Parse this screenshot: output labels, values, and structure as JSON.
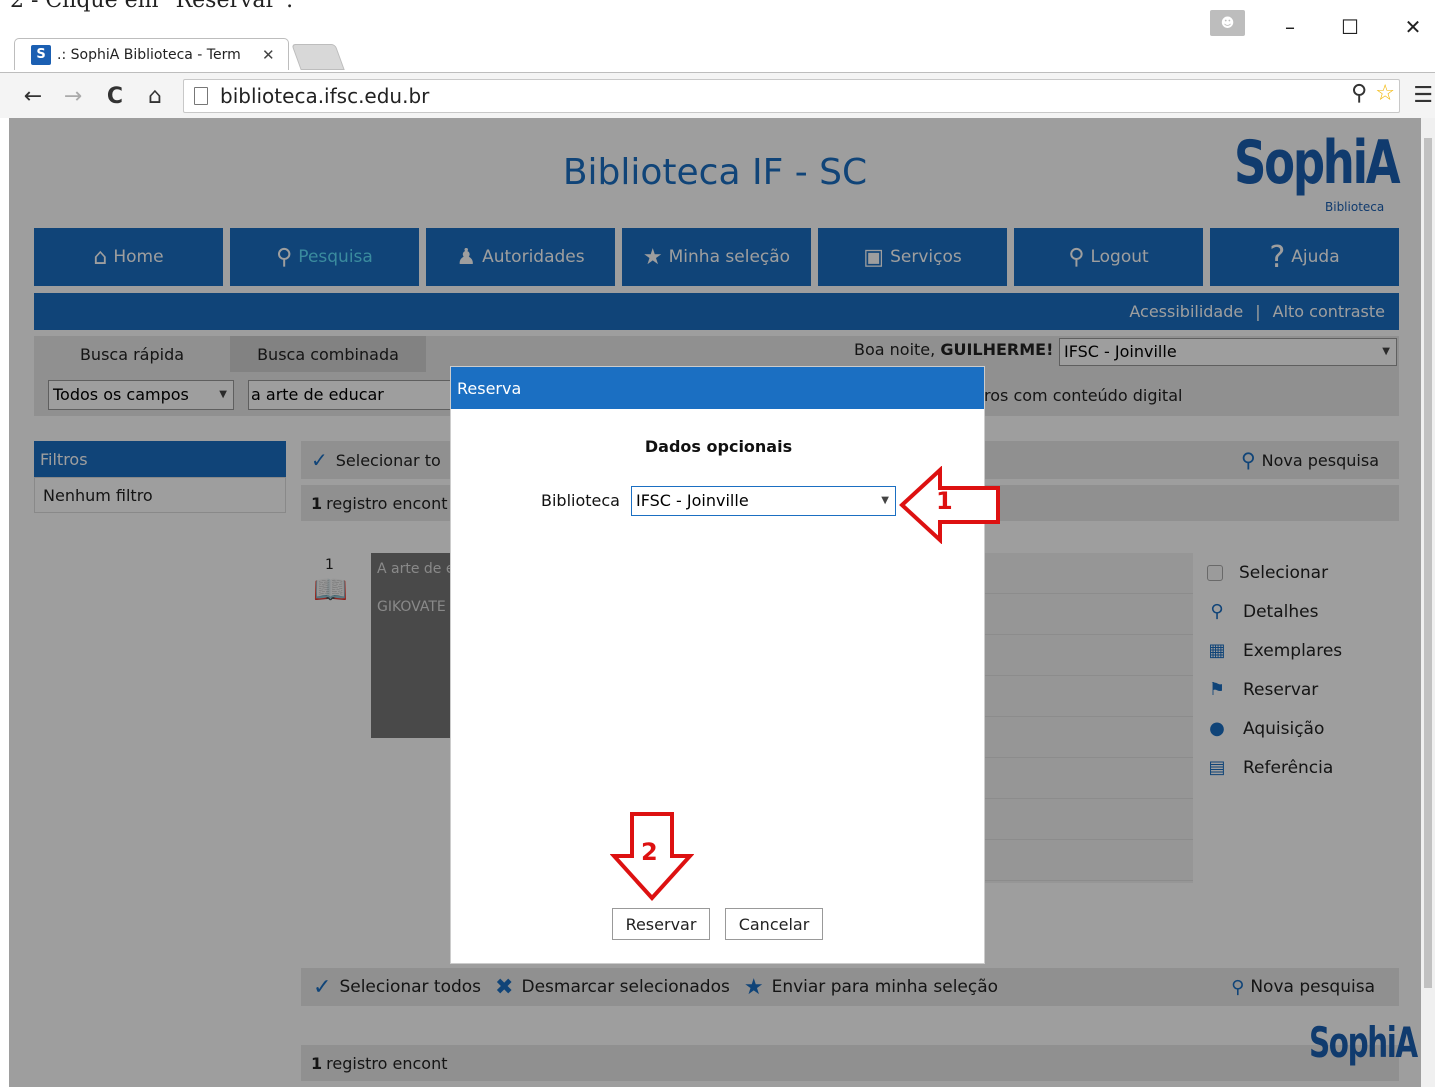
{
  "instruction": "2 - Clique em \"Reservar\".",
  "window": {
    "minimize": "–",
    "maximize": "☐",
    "close": "✕"
  },
  "tab": {
    "favicon": "S",
    "title": ".: SophiA Biblioteca - Term",
    "close": "✕"
  },
  "address": {
    "url": "biblioteca.ifsc.edu.br"
  },
  "site": {
    "title": "Biblioteca IF - SC",
    "logo": "SophiA",
    "logo_sub": "Biblioteca"
  },
  "nav": [
    {
      "label": "Home",
      "icon": "home-icon"
    },
    {
      "label": "Pesquisa",
      "icon": "search-icon"
    },
    {
      "label": "Autoridades",
      "icon": "authors-icon"
    },
    {
      "label": "Minha seleção",
      "icon": "star-icon"
    },
    {
      "label": "Serviços",
      "icon": "services-icon"
    },
    {
      "label": "Logout",
      "icon": "key-icon"
    },
    {
      "label": "Ajuda",
      "icon": "help-icon"
    }
  ],
  "subbar": {
    "accessibility": "Acessibilidade",
    "separator": "|",
    "contrast": "Alto contraste"
  },
  "search": {
    "tab_quick": "Busca rápida",
    "tab_combined": "Busca combinada",
    "greeting": "Boa noite,",
    "user": "GUILHERME!",
    "library": "IFSC - Joinville",
    "field": "Todos os campos",
    "query": "a arte de educar",
    "digital": "ros com conteúdo digital"
  },
  "filters": {
    "header": "Filtros",
    "none": "Nenhum filtro"
  },
  "results": {
    "select_all_partial": "Selecionar to",
    "new_search": "Nova pesquisa",
    "count_partial": "registro encont",
    "count_num": "1",
    "record_num": "1",
    "cover_title": "A arte de e",
    "cover_author": "GIKOVATE"
  },
  "actions": [
    {
      "label": "Selecionar",
      "icon": "checkbox-icon"
    },
    {
      "label": "Detalhes",
      "icon": "magnifier-icon"
    },
    {
      "label": "Exemplares",
      "icon": "books-icon"
    },
    {
      "label": "Reservar",
      "icon": "flag-icon"
    },
    {
      "label": "Aquisição",
      "icon": "lightbulb-icon"
    },
    {
      "label": "Referência",
      "icon": "reference-icon"
    }
  ],
  "bottom": {
    "select_all": "Selecionar todos",
    "unselect": "Desmarcar selecionados",
    "send": "Enviar para minha seleção",
    "new_search": "Nova pesquisa"
  },
  "modal": {
    "title": "Reserva",
    "subtitle": "Dados opcionais",
    "library_label": "Biblioteca",
    "library_value": "IFSC - Joinville",
    "reserve": "Reservar",
    "cancel": "Cancelar"
  },
  "annotations": {
    "one": "1",
    "two": "2"
  },
  "colors": {
    "brand": "#1b6fc2",
    "annotation": "#dd1111"
  }
}
